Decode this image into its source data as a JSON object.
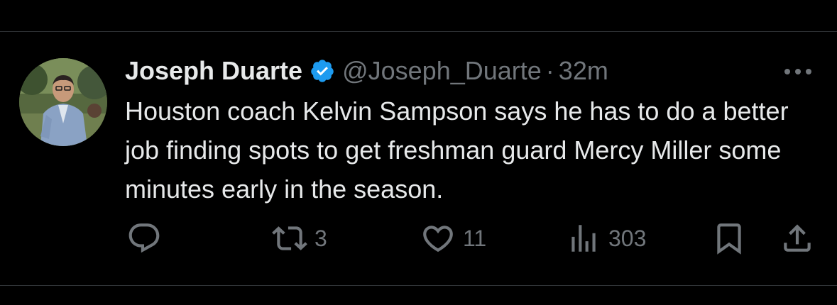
{
  "tweet": {
    "author": {
      "name": "Joseph Duarte",
      "handle": "@Joseph_Duarte",
      "verified": true
    },
    "separator": "·",
    "time": "32m",
    "text": "Houston coach Kelvin Sampson says he has to do a better job finding spots to get freshman guard Mercy Miller some minutes early in the season.",
    "stats": {
      "replies": "",
      "reposts": "3",
      "likes": "11",
      "views": "303"
    }
  },
  "icons": {
    "verified": "verified-badge-icon",
    "more": "more-options-icon",
    "reply": "reply-bubble-icon",
    "repost": "repost-arrows-icon",
    "like": "heart-icon",
    "views": "bar-chart-icon",
    "bookmark": "bookmark-icon",
    "share": "share-upload-icon"
  },
  "colors": {
    "background": "#000000",
    "primary_text": "#e7e9ea",
    "secondary_text": "#71767b",
    "divider": "#2f3336",
    "verified": "#1d9bf0"
  }
}
